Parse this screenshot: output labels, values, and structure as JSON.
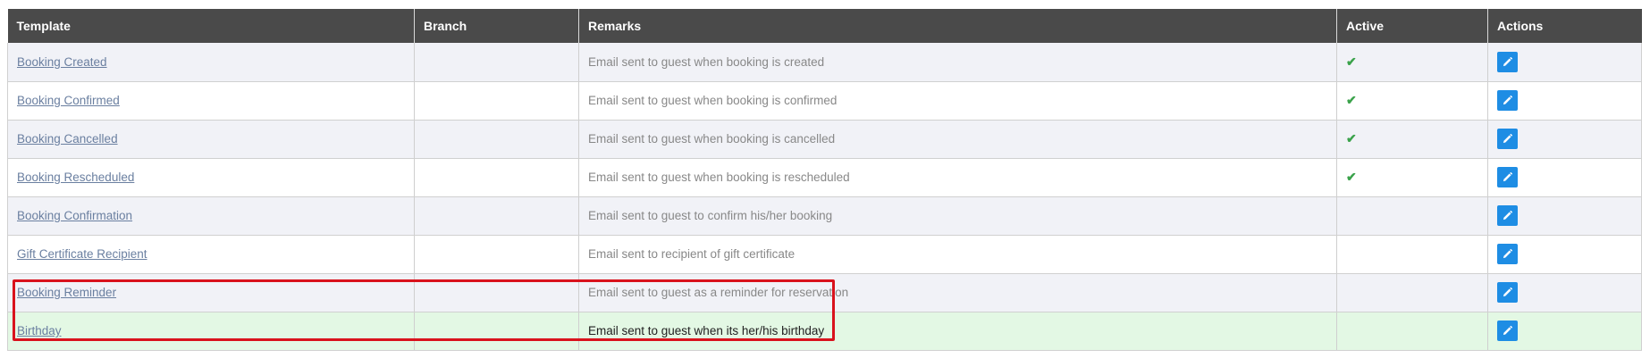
{
  "headers": {
    "template": "Template",
    "branch": "Branch",
    "remarks": "Remarks",
    "active": "Active",
    "actions": "Actions"
  },
  "rows": [
    {
      "template": "Booking Created",
      "branch": "",
      "remarks": "Email sent to guest when booking is created",
      "active": true
    },
    {
      "template": "Booking Confirmed",
      "branch": "",
      "remarks": "Email sent to guest when booking is confirmed",
      "active": true
    },
    {
      "template": "Booking Cancelled",
      "branch": "",
      "remarks": "Email sent to guest when booking is cancelled",
      "active": true
    },
    {
      "template": "Booking Rescheduled",
      "branch": "",
      "remarks": "Email sent to guest when booking is rescheduled",
      "active": true
    },
    {
      "template": "Booking Confirmation",
      "branch": "",
      "remarks": "Email sent to guest to confirm his/her booking",
      "active": false
    },
    {
      "template": "Gift Certificate Recipient",
      "branch": "",
      "remarks": "Email sent to recipient of gift certificate",
      "active": false
    },
    {
      "template": "Booking Reminder",
      "branch": "",
      "remarks": "Email sent to guest as a reminder for reservation",
      "active": false
    },
    {
      "template": "Birthday",
      "branch": "",
      "remarks": "Email sent to guest when its her/his birthday",
      "active": false
    }
  ],
  "icons": {
    "active": "check-icon",
    "edit": "pencil-icon"
  },
  "colors": {
    "header_bg": "#4a4a4a",
    "row_alt_bg": "#f1f2f7",
    "highlight_row_bg": "#e3f8e4",
    "check": "#3aa24a",
    "edit_button": "#1e8de4",
    "annotation_box": "#d9121c"
  }
}
